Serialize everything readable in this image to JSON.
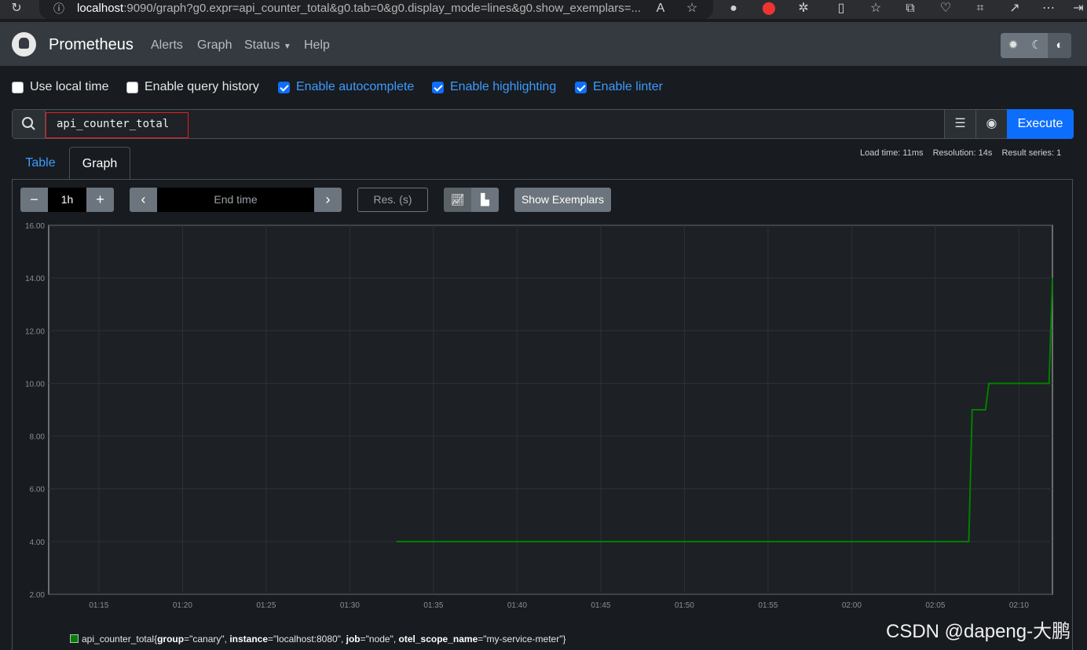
{
  "browser": {
    "url_host": "localhost",
    "url_rest": ":9090/graph?g0.expr=api_counter_total&g0.tab=0&g0.display_mode=lines&g0.show_exemplars=..."
  },
  "nav": {
    "brand": "Prometheus",
    "links": [
      "Alerts",
      "Graph",
      "Status",
      "Help"
    ]
  },
  "options": [
    {
      "label": "Use local time",
      "checked": false
    },
    {
      "label": "Enable query history",
      "checked": false
    },
    {
      "label": "Enable autocomplete",
      "checked": true
    },
    {
      "label": "Enable highlighting",
      "checked": true
    },
    {
      "label": "Enable linter",
      "checked": true
    }
  ],
  "query": {
    "expr": "api_counter_total",
    "execute_label": "Execute"
  },
  "stats": {
    "load": "Load time: 11ms",
    "resolution": "Resolution: 14s",
    "series": "Result series: 1"
  },
  "tabs": {
    "table": "Table",
    "graph": "Graph"
  },
  "controls": {
    "range": "1h",
    "end_placeholder": "End time",
    "res_placeholder": "Res. (s)",
    "exemplars_label": "Show Exemplars"
  },
  "chart_data": {
    "type": "line",
    "y_ticks": [
      "2.00",
      "4.00",
      "6.00",
      "8.00",
      "10.00",
      "12.00",
      "14.00",
      "16.00"
    ],
    "ylim": [
      2,
      16
    ],
    "x_ticks": [
      "01:15",
      "01:20",
      "01:25",
      "01:30",
      "01:35",
      "01:40",
      "01:45",
      "01:50",
      "01:55",
      "02:00",
      "02:05",
      "02:10"
    ],
    "x_start_minute": 72.0,
    "x_end_minute": 132.0,
    "series": [
      {
        "color": "#008000",
        "points": [
          [
            92.8,
            4
          ],
          [
            127.0,
            4
          ],
          [
            127.2,
            9
          ],
          [
            128.0,
            9
          ],
          [
            128.2,
            10
          ],
          [
            131.8,
            10
          ],
          [
            132.0,
            14
          ]
        ]
      }
    ]
  },
  "legend": {
    "metric": "api_counter_total",
    "labels": [
      {
        "key": "group",
        "value": "\"canary\""
      },
      {
        "key": "instance",
        "value": "\"localhost:8080\""
      },
      {
        "key": "job",
        "value": "\"node\""
      },
      {
        "key": "otel_scope_name",
        "value": "\"my-service-meter\""
      }
    ]
  },
  "watermark": "CSDN @dapeng-大鹏"
}
